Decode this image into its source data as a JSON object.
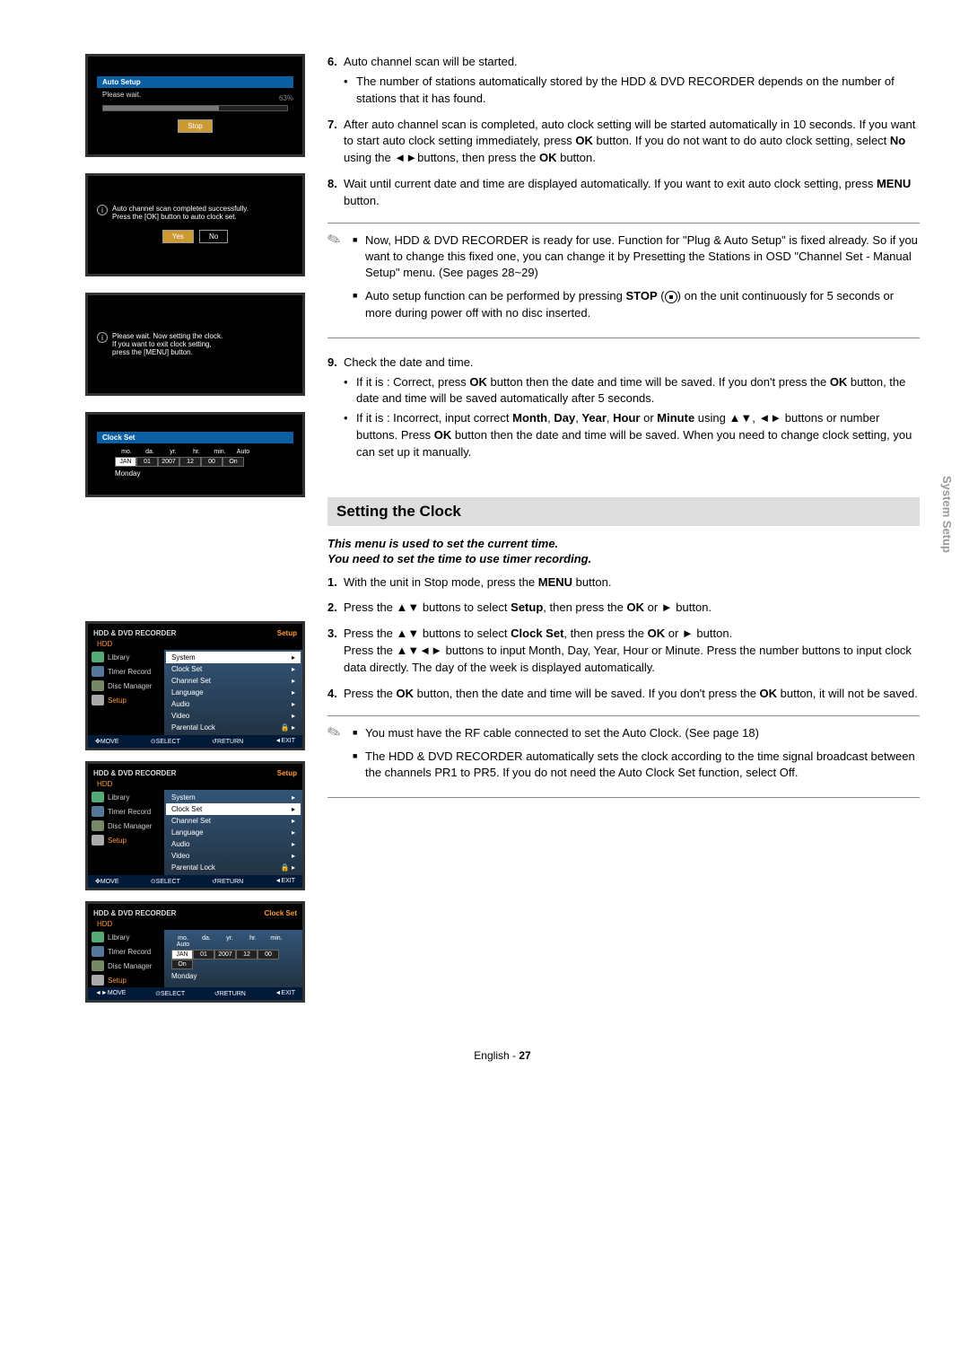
{
  "screens": {
    "s1": {
      "title": "Auto Setup",
      "wait": "Please wait.",
      "percent": "63%",
      "stop": "Stop"
    },
    "s2": {
      "line1": "Auto channel scan completed successfully.",
      "line2": "Press the [OK] button to auto clock set.",
      "yes": "Yes",
      "no": "No"
    },
    "s3": {
      "line1": "Please wait. Now setting the clock.",
      "line2": "If you want to exit clock setting,",
      "line3": "press the [MENU] button."
    },
    "s4": {
      "title": "Clock Set",
      "cols": {
        "c1": "mo.",
        "c2": "da.",
        "c3": "yr.",
        "c4": "hr.",
        "c5": "min.",
        "c6": "Auto"
      },
      "vals": {
        "v1": "JAN",
        "v2": "01",
        "v3": "2007",
        "v4": "12",
        "v5": "00",
        "v6": "On"
      },
      "day": "Monday"
    }
  },
  "menu": {
    "top_title": "HDD & DVD RECORDER",
    "top_right": "Setup",
    "top_right_cs": "Clock Set",
    "tab": "HDD",
    "left": {
      "l1": "Library",
      "l2": "Timer Record",
      "l3": "Disc Manager",
      "l4": "Setup"
    },
    "r1": {
      "i1": "System",
      "i2": "Clock Set",
      "i3": "Channel Set",
      "i4": "Language",
      "i5": "Audio",
      "i6": "Video",
      "i7": "Parental Lock"
    },
    "bot": {
      "b1": "MOVE",
      "b2": "SELECT",
      "b3": "RETURN",
      "b4": "EXIT"
    }
  },
  "text": {
    "step6": "Auto channel scan will be started.",
    "step6b": "The number of stations automatically stored by the HDD & DVD RECORDER depends on the number of stations that it has found.",
    "step7a": "After auto channel scan is completed, auto clock setting will be started automatically in 10 seconds. If you want to start auto clock setting immediately, press ",
    "step7b": " button. If you do not want to do auto clock setting, select ",
    "step7c": " using the ◄►buttons, then press the ",
    "step7d": " button.",
    "ok": "OK",
    "no": "No",
    "step8a": "Wait until current date and time are displayed automatically. If you want to exit auto clock setting, press ",
    "step8b": " button.",
    "menu": "MENU",
    "note1": "Now, HDD & DVD RECORDER is ready for use. Function for \"Plug & Auto Setup\" is fixed already. So if you want to change this fixed one, you can change it by Presetting the Stations in OSD \"Channel Set - Manual Setup\" menu. (See pages 28~29)",
    "note2a": "Auto setup function can be performed by pressing ",
    "note2b": " on the unit continuously for 5 seconds or more during power off with no disc inserted.",
    "stop": "STOP",
    "step9": "Check the date and time.",
    "step9a1": "If it is : Correct, press ",
    "step9a2": " button then the date and time will be saved. If you don't press the ",
    "step9a3": " button, the date and time will be saved automatically after 5 seconds.",
    "step9b1": "If it is : Incorrect, input correct ",
    "step9b2": " using ▲▼, ◄► buttons or number buttons. Press ",
    "step9b3": " button then the date and time will be saved. When you need to change clock setting, you can set up it manually.",
    "m": "Month",
    "d": "Day",
    "y": "Year",
    "h": "Hour",
    "mi": "Minute",
    "or": " or ",
    "c": ", ",
    "sec_title": "Setting the Clock",
    "intro1": "This menu is used to set the current time.",
    "intro2": "You need to set the time to use timer recording.",
    "c1": "With the unit in Stop mode, press the ",
    "c1b": " button.",
    "c2a": "Press the ▲▼ buttons to select ",
    "c2b": ", then press the ",
    "c2c": " or ► button.",
    "setup": "Setup",
    "clockset": "Clock Set",
    "c3a": "Press the ▲▼ buttons to select ",
    "c3b": ", then press the ",
    "c3c": " or ► button.",
    "c3d": "Press the ▲▼◄► buttons to input Month, Day, Year, Hour or Minute. Press the number buttons to input clock data directly. The day of the week is displayed automatically.",
    "c4a": "Press the ",
    "c4b": " button, then the date and time will be saved. If you don't press the ",
    "c4c": " button, it will not be saved.",
    "note3": "You must have the RF cable connected to set the Auto Clock. (See page 18)",
    "note4": "The HDD & DVD RECORDER automatically sets the clock according to the time signal broadcast between the channels PR1 to PR5. If you do not need the Auto Clock Set function, select Off.",
    "side": "System Setup",
    "footer_a": "English - ",
    "footer_b": "27"
  }
}
